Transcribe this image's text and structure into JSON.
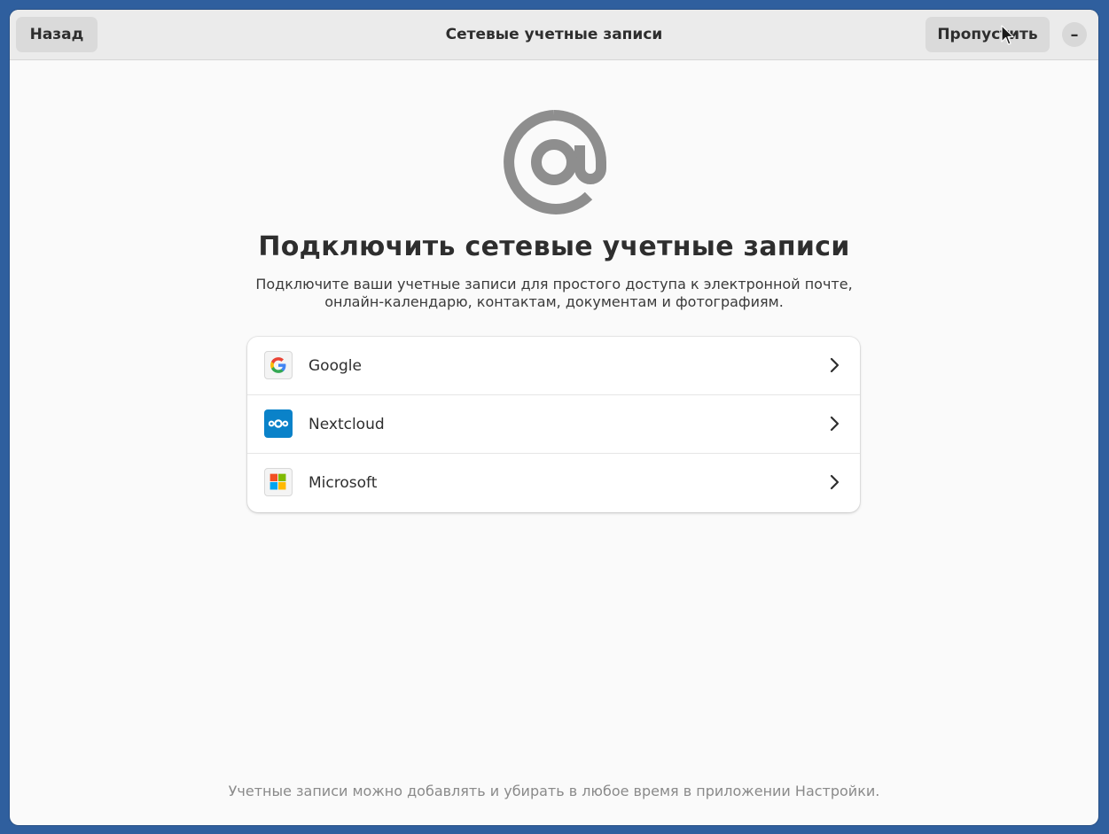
{
  "window": {
    "title": "Сетевые учетные записи"
  },
  "header": {
    "back_label": "Назад",
    "skip_label": "Пропустить",
    "minimize_symbol": "–"
  },
  "main": {
    "icon": "at-sign-icon",
    "heading": "Подключить сетевые учетные записи",
    "description_line1": "Подключите ваши учетные записи для простого доступа к электронной почте,",
    "description_line2": "онлайн-календарю, контактам, документам и фотографиям."
  },
  "providers": [
    {
      "label": "Google",
      "icon": "google-icon"
    },
    {
      "label": "Nextcloud",
      "icon": "nextcloud-icon"
    },
    {
      "label": "Microsoft",
      "icon": "microsoft-icon"
    }
  ],
  "footer": {
    "note": "Учетные записи можно добавлять и убирать в любое время в приложении Настройки."
  },
  "colors": {
    "desktop_background": "#2f5f9e",
    "window_background": "#fafafa",
    "headerbar_background": "#ebebeb",
    "button_background": "#dadada",
    "icon_gray": "#8e8e8e",
    "nextcloud_blue": "#0a82c9"
  }
}
